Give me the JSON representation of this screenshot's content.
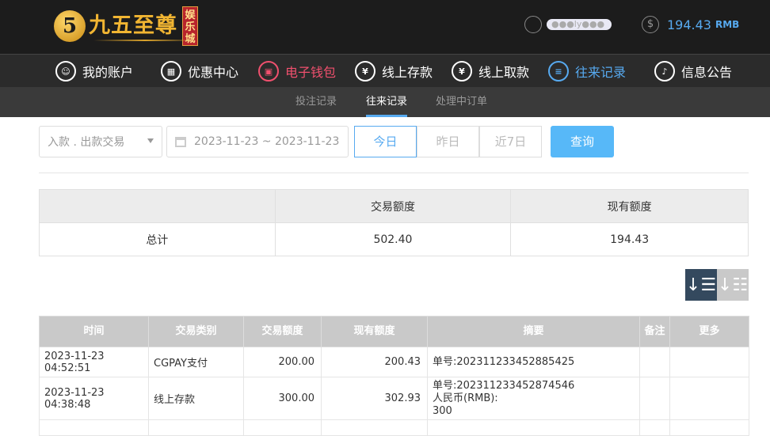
{
  "brand": {
    "logo_mark": "5",
    "name": "九五至尊",
    "seal": "娱乐城"
  },
  "account": {
    "username_masked": "●●●ly●●●",
    "balance": "194.43",
    "currency": "RMB"
  },
  "nav": [
    {
      "label": "我的账户",
      "icon": "user-circle-icon"
    },
    {
      "label": "优惠中心",
      "icon": "gift-icon"
    },
    {
      "label": "电子钱包",
      "icon": "wallet-icon"
    },
    {
      "label": "线上存款",
      "icon": "deposit-icon"
    },
    {
      "label": "线上取款",
      "icon": "withdraw-icon"
    },
    {
      "label": "往来记录",
      "icon": "records-icon"
    },
    {
      "label": "信息公告",
      "icon": "bell-icon"
    }
  ],
  "subnav": [
    {
      "label": "投注记录"
    },
    {
      "label": "往来记录"
    },
    {
      "label": "处理中订单"
    }
  ],
  "filter": {
    "type_value": "入款 . 出款交易",
    "date_range": "2023-11-23 ~ 2023-11-23",
    "today": "今日",
    "yesterday": "昨日",
    "last7": "近7日",
    "query": "查询"
  },
  "summary": {
    "headers": [
      "",
      "交易额度",
      "现有额度"
    ],
    "row": [
      "总计",
      "502.40",
      "194.43"
    ]
  },
  "table": {
    "headers": [
      "时间",
      "交易类别",
      "交易额度",
      "现有额度",
      "摘要",
      "备注",
      "更多"
    ],
    "rows": [
      [
        "2023-11-23 04:52:51",
        "CGPAY支付",
        "200.00",
        "200.43",
        "单号:202311233452885425",
        "",
        ""
      ],
      [
        "2023-11-23 04:38:48",
        "线上存款",
        "300.00",
        "302.93",
        "单号:202311233452874546\n人民币(RMB):\n300",
        "",
        ""
      ]
    ]
  },
  "colors": {
    "accent": "#57aaf0",
    "active_red": "#f0506e",
    "topbar": "#1c1c1c",
    "nav": "#2b2b2b"
  }
}
